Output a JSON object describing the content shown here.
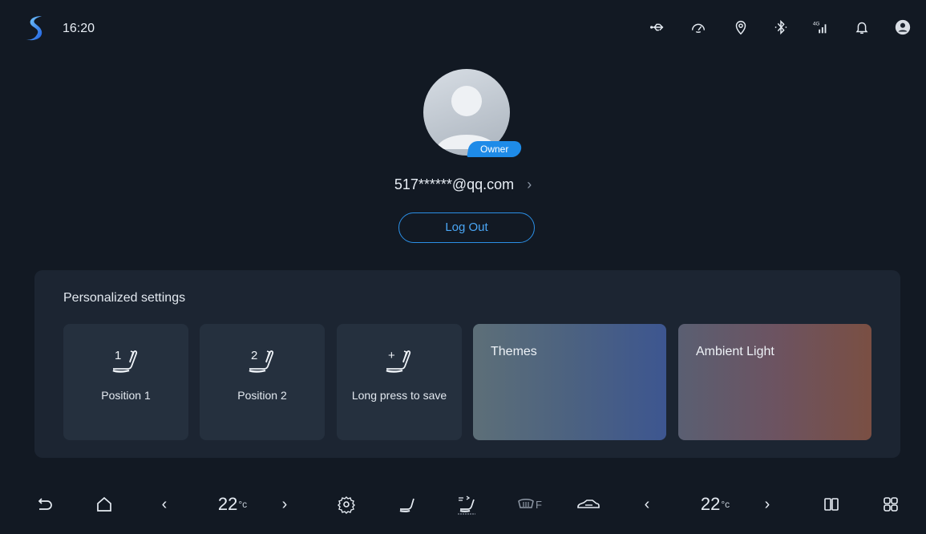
{
  "status": {
    "time": "16:20",
    "signal_label": "4G"
  },
  "profile": {
    "badge": "Owner",
    "account": "517******@qq.com",
    "chevron": "›",
    "logout_label": "Log Out"
  },
  "settings": {
    "title": "Personalized settings",
    "positions": [
      {
        "label": "Position 1",
        "num": "1",
        "icon": "seat-position-1-icon"
      },
      {
        "label": "Position 2",
        "num": "2",
        "icon": "seat-position-2-icon"
      },
      {
        "label": "Long press to save",
        "num": "+",
        "icon": "seat-save-icon"
      }
    ],
    "themes_label": "Themes",
    "ambient_label": "Ambient Light"
  },
  "dock": {
    "left_temp": "22",
    "right_temp": "22",
    "temp_unit": "°c",
    "left_arrow": "‹",
    "right_arrow": "›",
    "defrost_label": "F"
  }
}
